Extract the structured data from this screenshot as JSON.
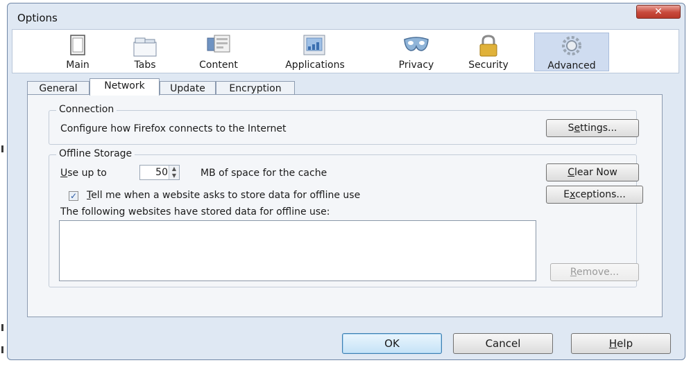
{
  "window": {
    "title": "Options",
    "close_glyph": "✕"
  },
  "toolbar": {
    "panes": [
      {
        "label": "Main",
        "icon": "main-icon"
      },
      {
        "label": "Tabs",
        "icon": "tabs-icon"
      },
      {
        "label": "Content",
        "icon": "content-icon"
      },
      {
        "label": "Applications",
        "icon": "applications-icon"
      },
      {
        "label": "Privacy",
        "icon": "privacy-icon"
      },
      {
        "label": "Security",
        "icon": "security-icon"
      },
      {
        "label": "Advanced",
        "icon": "advanced-icon"
      }
    ],
    "selected": "Advanced"
  },
  "subtabs": {
    "items": [
      "General",
      "Network",
      "Update",
      "Encryption"
    ],
    "active": "Network"
  },
  "connection": {
    "group_label": "Connection",
    "description": "Configure how Firefox connects to the Internet",
    "settings_button": {
      "pre": "S",
      "mnemonic": "e",
      "post": "ttings..."
    }
  },
  "offline": {
    "group_label": "Offline Storage",
    "use_up_to": {
      "mnemonic": "U",
      "post": "se up to"
    },
    "cache_value": "50",
    "cache_unit_text": "MB of space for the cache",
    "clear_now_button": {
      "mnemonic": "C",
      "post": "lear Now"
    },
    "tell_me": {
      "mnemonic": "T",
      "post": "ell me when a website asks to store data for offline use",
      "checked": true
    },
    "exceptions_button": {
      "pre": "E",
      "mnemonic": "x",
      "post": "ceptions..."
    },
    "stored_label": "The following websites have stored data for offline use:",
    "remove_button": {
      "mnemonic": "R",
      "post": "emove..."
    }
  },
  "footer": {
    "ok": "OK",
    "cancel": "Cancel",
    "help": {
      "mnemonic": "H",
      "post": "elp"
    }
  },
  "colors": {
    "accent": "#cfdcf0",
    "window_bg": "#dfe8f3",
    "close": "#c8493b"
  }
}
